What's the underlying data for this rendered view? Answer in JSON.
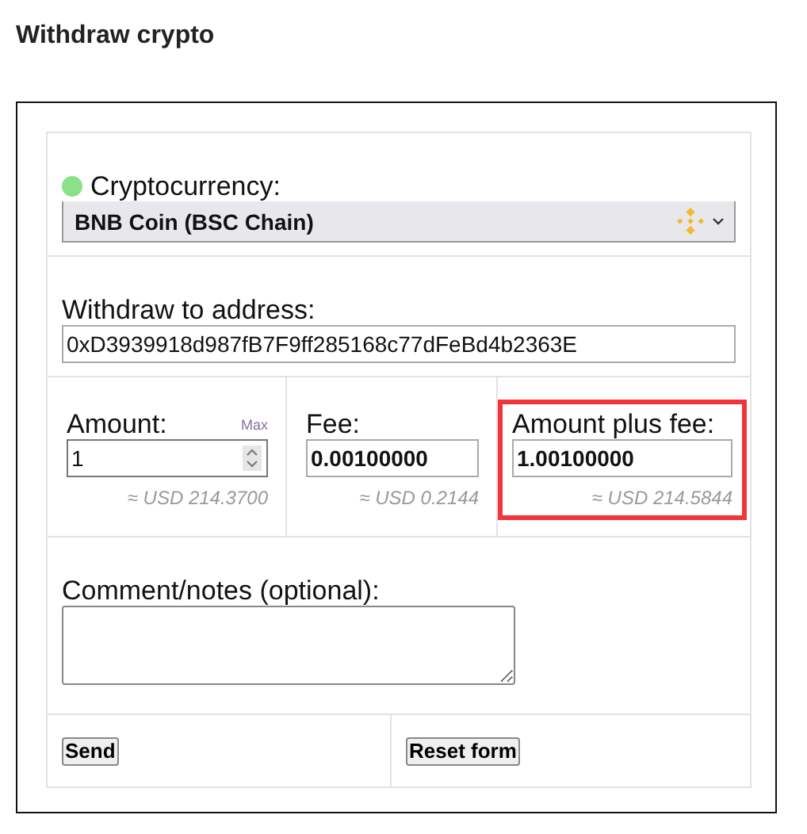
{
  "title": "Withdraw crypto",
  "cryptocurrency": {
    "label": "Cryptocurrency:",
    "color": "#8de08a",
    "value": "BNB Coin (BSC Chain)"
  },
  "address": {
    "label": "Withdraw to address:",
    "value": "0xD3939918d987fB7F9ff285168c77dFeBd4b2363E"
  },
  "amounts": [
    {
      "kind": "spinner",
      "label": "Amount:",
      "link": "Max",
      "value": "1",
      "usd": "≈ USD 214.3700",
      "highlighted": false
    },
    {
      "kind": "plain",
      "label": "Fee:",
      "value": "0.00100000",
      "usd": "≈ USD 0.2144",
      "highlighted": false
    },
    {
      "kind": "plain",
      "label": "Amount plus fee:",
      "value": "1.00100000",
      "usd": "≈ USD 214.5844",
      "highlighted": true
    }
  ],
  "comment": {
    "label": "Comment/notes (optional):"
  },
  "buttons": [
    "Send",
    "Reset form"
  ]
}
